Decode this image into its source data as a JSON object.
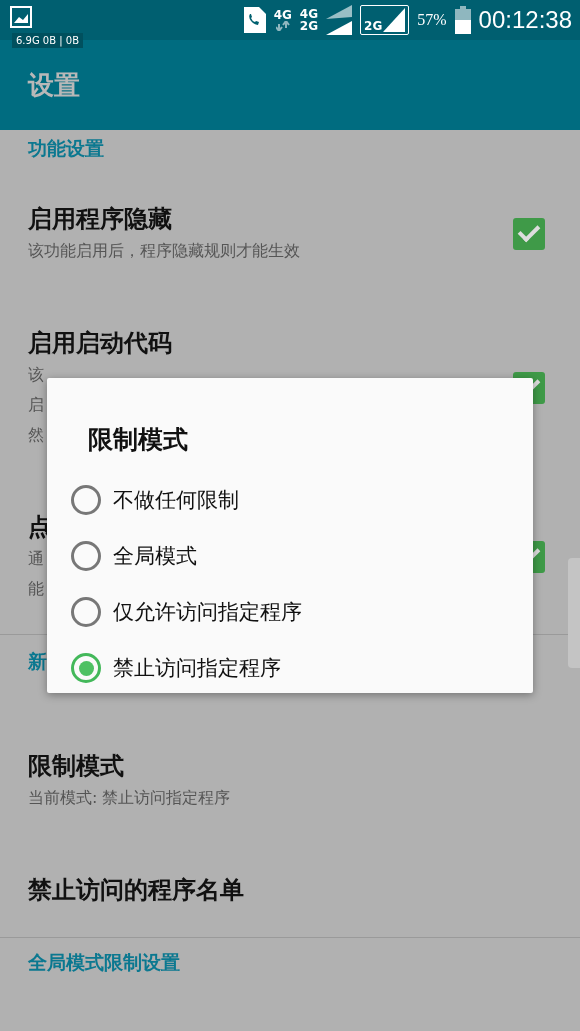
{
  "status_bar": {
    "net_speed": "6.9G 0B | 0B",
    "sim1_top": "4G",
    "sim2_top": "4G",
    "sim2_bottom": "2G",
    "sim3": "2G",
    "battery": "57%",
    "time": "00:12:38"
  },
  "app_bar": {
    "title": "设置"
  },
  "sections": [
    {
      "header": "功能设置",
      "items": [
        {
          "title": "启用程序隐藏",
          "summary_lines": [
            "该功能启用后，程序隐藏规则才能生效"
          ],
          "checked": true
        },
        {
          "title": "启用启动代码",
          "summary_lines": [
            "该",
            "启",
            "然"
          ],
          "checked": true
        },
        {
          "title": "点",
          "summary_lines": [
            "通",
            "能"
          ],
          "checked": true
        }
      ]
    },
    {
      "header_lines": [
        "新"
      ],
      "items": [
        {
          "title": "限制模式",
          "summary_lines": [
            "当前模式: 禁止访问指定程序"
          ]
        },
        {
          "title": "禁止访问的程序名单"
        }
      ]
    },
    {
      "header": "全局模式限制设置"
    }
  ],
  "dialog": {
    "title": "限制模式",
    "options": [
      {
        "label": "不做任何限制",
        "selected": false
      },
      {
        "label": "全局模式",
        "selected": false
      },
      {
        "label": "仅允许访问指定程序",
        "selected": false
      },
      {
        "label": "禁止访问指定程序",
        "selected": true
      }
    ]
  }
}
